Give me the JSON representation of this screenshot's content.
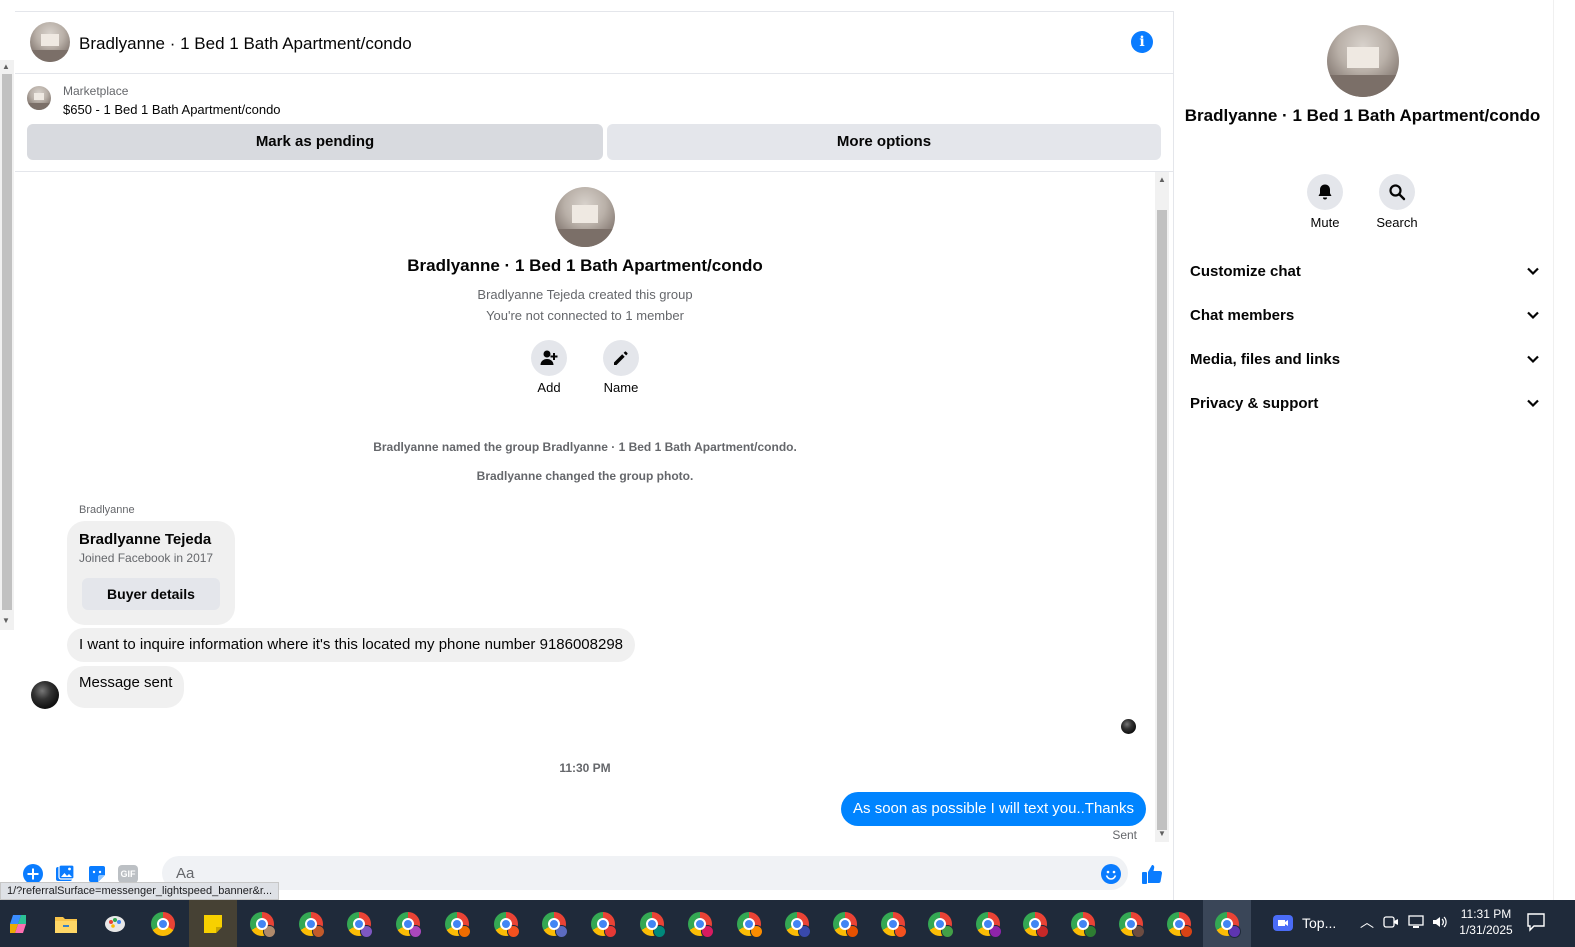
{
  "header": {
    "title": "Bradlyanne · 1 Bed 1 Bath Apartment/condo"
  },
  "marketplace": {
    "label": "Marketplace",
    "listing": "$650 - 1 Bed 1 Bath Apartment/condo",
    "pending_button": "Mark as pending",
    "more_button": "More options"
  },
  "intro": {
    "title": "Bradlyanne · 1 Bed 1 Bath Apartment/condo",
    "created": "Bradlyanne Tejeda created this group",
    "connected": "You're not connected to 1 member",
    "add_label": "Add",
    "name_label": "Name"
  },
  "system_messages": [
    "Bradlyanne named the group Bradlyanne · 1 Bed 1 Bath Apartment/condo.",
    "Bradlyanne changed the group photo."
  ],
  "messages": {
    "sender": "Bradlyanne",
    "card_name": "Bradlyanne Tejeda",
    "card_sub": "Joined Facebook in 2017",
    "card_button": "Buyer details",
    "incoming_1": "I want to inquire information where it's this located my phone number 9186008298",
    "incoming_2": "Message sent",
    "timestamp": "11:30 PM",
    "outgoing_1": "As soon as possible I will text you..Thanks",
    "status": "Sent"
  },
  "composer": {
    "placeholder": "Aa",
    "gif_label": "GIF"
  },
  "status_url": "1/?referralSurface=messenger_lightspeed_banner&r...",
  "right_panel": {
    "title": "Bradlyanne · 1 Bed 1 Bath Apartment/condo",
    "mute_label": "Mute",
    "search_label": "Search",
    "sections": [
      {
        "label": "Customize chat"
      },
      {
        "label": "Chat members"
      },
      {
        "label": "Media, files and links"
      },
      {
        "label": "Privacy & support"
      }
    ]
  },
  "taskbar": {
    "zoom_label": "Top...",
    "time": "11:31 PM",
    "date": "1/31/2025"
  },
  "colors": {
    "accent": "#0084ff",
    "info": "#0a7cff",
    "bubble_in": "#f0f0f0",
    "taskbar": "#1f2a3a"
  }
}
